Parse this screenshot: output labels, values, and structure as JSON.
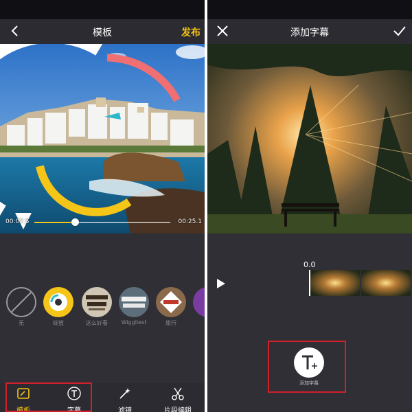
{
  "left": {
    "nav": {
      "title": "模板",
      "publish": "发布",
      "back_icon": "chevron-left-icon"
    },
    "preview": {
      "time_current": "00:07.5",
      "time_total": "00:25.1",
      "progress": 0.3
    },
    "templates": [
      {
        "label": "无",
        "kind": "none"
      },
      {
        "label": "绽放",
        "kind": "bloom",
        "selected": true
      },
      {
        "label": "这么好看",
        "kind": "text-gold"
      },
      {
        "label": "Wiggliest",
        "kind": "only-you"
      },
      {
        "label": "旅行",
        "kind": "travel"
      },
      {
        "label": "",
        "kind": "partial"
      }
    ],
    "tabs": [
      {
        "label": "模板",
        "icon": "template-icon",
        "active": true
      },
      {
        "label": "字幕",
        "icon": "subtitle-t-icon",
        "active": false
      },
      {
        "label": "滤镜",
        "icon": "magic-wand-icon",
        "active": false
      },
      {
        "label": "片段编辑",
        "icon": "scissors-icon",
        "active": false
      }
    ],
    "colors": {
      "accent": "#f5c518",
      "highlight_box": "#d0202a"
    }
  },
  "right": {
    "nav": {
      "title": "添加字幕",
      "close_icon": "close-icon",
      "confirm_icon": "checkmark-icon"
    },
    "timeline": {
      "timecode": "0.0"
    },
    "add_caption": {
      "label": "添加字幕",
      "icon": "text-add-icon"
    }
  }
}
